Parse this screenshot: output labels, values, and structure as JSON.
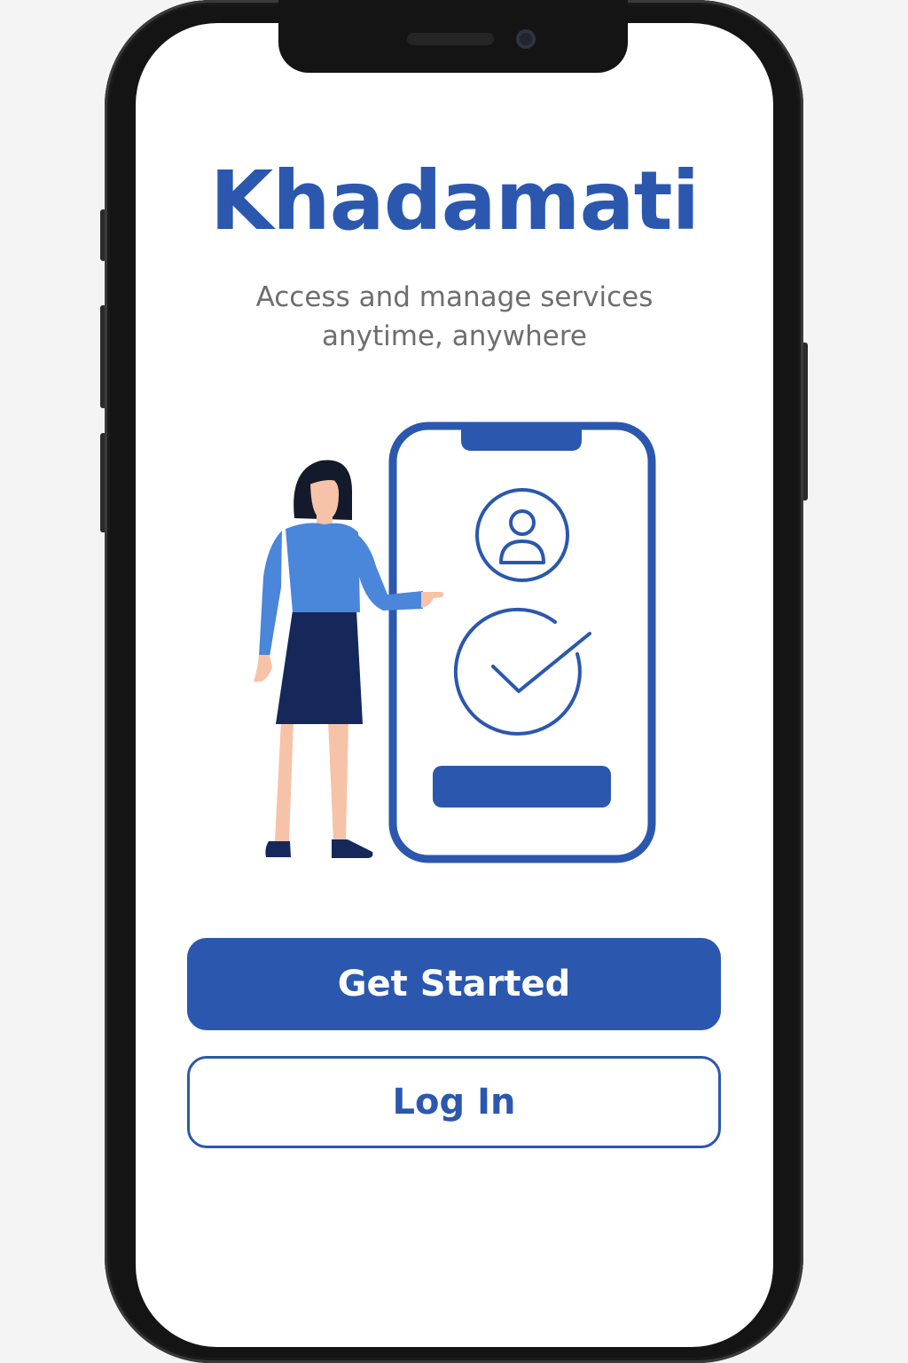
{
  "app": {
    "name": "Khadamati",
    "tagline_line1": "Access and manage services",
    "tagline_line2": "anytime, anywhere"
  },
  "actions": {
    "get_started_label": "Get Started",
    "log_in_label": "Log In"
  },
  "illustration": {
    "icons": [
      "person-illustration",
      "phone-outline-icon",
      "user-profile-icon",
      "checkmark-circle-icon"
    ]
  },
  "colors": {
    "brand": "#2b58ae",
    "text_muted": "#6e6e6e",
    "shirt": "#4a86d9",
    "skirt": "#16285a",
    "skin": "#f6c3a8"
  }
}
